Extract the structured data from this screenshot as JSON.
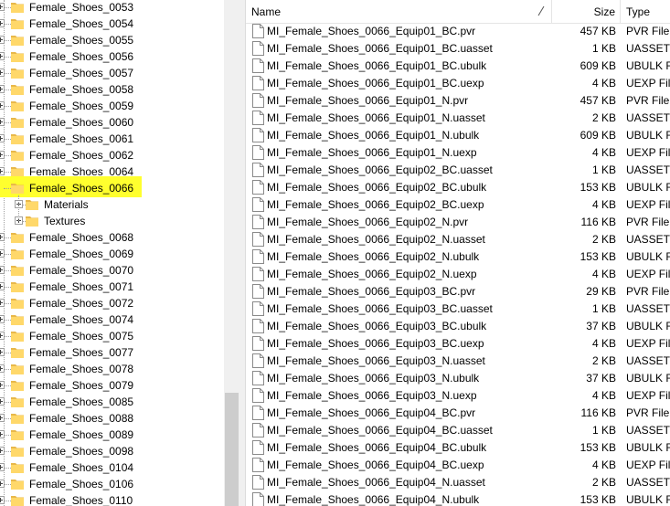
{
  "tree": {
    "items": [
      {
        "label": "Female_Shoes_0053",
        "level": 0
      },
      {
        "label": "Female_Shoes_0054",
        "level": 0
      },
      {
        "label": "Female_Shoes_0055",
        "level": 0
      },
      {
        "label": "Female_Shoes_0056",
        "level": 0
      },
      {
        "label": "Female_Shoes_0057",
        "level": 0
      },
      {
        "label": "Female_Shoes_0058",
        "level": 0
      },
      {
        "label": "Female_Shoes_0059",
        "level": 0
      },
      {
        "label": "Female_Shoes_0060",
        "level": 0
      },
      {
        "label": "Female_Shoes_0061",
        "level": 0
      },
      {
        "label": "Female_Shoes_0062",
        "level": 0
      },
      {
        "label": "Female_Shoes_0064",
        "level": 0
      },
      {
        "label": "Female_Shoes_0066",
        "level": 0,
        "selected": true
      },
      {
        "label": "Materials",
        "level": 1
      },
      {
        "label": "Textures",
        "level": 1
      },
      {
        "label": "Female_Shoes_0068",
        "level": 0
      },
      {
        "label": "Female_Shoes_0069",
        "level": 0
      },
      {
        "label": "Female_Shoes_0070",
        "level": 0
      },
      {
        "label": "Female_Shoes_0071",
        "level": 0
      },
      {
        "label": "Female_Shoes_0072",
        "level": 0
      },
      {
        "label": "Female_Shoes_0074",
        "level": 0
      },
      {
        "label": "Female_Shoes_0075",
        "level": 0
      },
      {
        "label": "Female_Shoes_0077",
        "level": 0
      },
      {
        "label": "Female_Shoes_0078",
        "level": 0
      },
      {
        "label": "Female_Shoes_0079",
        "level": 0
      },
      {
        "label": "Female_Shoes_0085",
        "level": 0
      },
      {
        "label": "Female_Shoes_0088",
        "level": 0
      },
      {
        "label": "Female_Shoes_0089",
        "level": 0
      },
      {
        "label": "Female_Shoes_0098",
        "level": 0
      },
      {
        "label": "Female_Shoes_0104",
        "level": 0
      },
      {
        "label": "Female_Shoes_0106",
        "level": 0
      },
      {
        "label": "Female_Shoes_0110",
        "level": 0
      }
    ]
  },
  "list": {
    "headers": {
      "name": "Name",
      "size": "Size",
      "type": "Type"
    },
    "files": [
      {
        "name": "MI_Female_Shoes_0066_Equip01_BC.pvr",
        "size": "457 KB",
        "type": "PVR File"
      },
      {
        "name": "MI_Female_Shoes_0066_Equip01_BC.uasset",
        "size": "1 KB",
        "type": "UASSET Fi"
      },
      {
        "name": "MI_Female_Shoes_0066_Equip01_BC.ubulk",
        "size": "609 KB",
        "type": "UBULK Fi"
      },
      {
        "name": "MI_Female_Shoes_0066_Equip01_BC.uexp",
        "size": "4 KB",
        "type": "UEXP File"
      },
      {
        "name": "MI_Female_Shoes_0066_Equip01_N.pvr",
        "size": "457 KB",
        "type": "PVR File"
      },
      {
        "name": "MI_Female_Shoes_0066_Equip01_N.uasset",
        "size": "2 KB",
        "type": "UASSET Fi"
      },
      {
        "name": "MI_Female_Shoes_0066_Equip01_N.ubulk",
        "size": "609 KB",
        "type": "UBULK Fi"
      },
      {
        "name": "MI_Female_Shoes_0066_Equip01_N.uexp",
        "size": "4 KB",
        "type": "UEXP File"
      },
      {
        "name": "MI_Female_Shoes_0066_Equip02_BC.uasset",
        "size": "1 KB",
        "type": "UASSET Fi"
      },
      {
        "name": "MI_Female_Shoes_0066_Equip02_BC.ubulk",
        "size": "153 KB",
        "type": "UBULK Fi"
      },
      {
        "name": "MI_Female_Shoes_0066_Equip02_BC.uexp",
        "size": "4 KB",
        "type": "UEXP File"
      },
      {
        "name": "MI_Female_Shoes_0066_Equip02_N.pvr",
        "size": "116 KB",
        "type": "PVR File"
      },
      {
        "name": "MI_Female_Shoes_0066_Equip02_N.uasset",
        "size": "2 KB",
        "type": "UASSET Fi"
      },
      {
        "name": "MI_Female_Shoes_0066_Equip02_N.ubulk",
        "size": "153 KB",
        "type": "UBULK Fi"
      },
      {
        "name": "MI_Female_Shoes_0066_Equip02_N.uexp",
        "size": "4 KB",
        "type": "UEXP File"
      },
      {
        "name": "MI_Female_Shoes_0066_Equip03_BC.pvr",
        "size": "29 KB",
        "type": "PVR File"
      },
      {
        "name": "MI_Female_Shoes_0066_Equip03_BC.uasset",
        "size": "1 KB",
        "type": "UASSET Fi"
      },
      {
        "name": "MI_Female_Shoes_0066_Equip03_BC.ubulk",
        "size": "37 KB",
        "type": "UBULK Fi"
      },
      {
        "name": "MI_Female_Shoes_0066_Equip03_BC.uexp",
        "size": "4 KB",
        "type": "UEXP File"
      },
      {
        "name": "MI_Female_Shoes_0066_Equip03_N.uasset",
        "size": "2 KB",
        "type": "UASSET Fi"
      },
      {
        "name": "MI_Female_Shoes_0066_Equip03_N.ubulk",
        "size": "37 KB",
        "type": "UBULK Fi"
      },
      {
        "name": "MI_Female_Shoes_0066_Equip03_N.uexp",
        "size": "4 KB",
        "type": "UEXP File"
      },
      {
        "name": "MI_Female_Shoes_0066_Equip04_BC.pvr",
        "size": "116 KB",
        "type": "PVR File"
      },
      {
        "name": "MI_Female_Shoes_0066_Equip04_BC.uasset",
        "size": "1 KB",
        "type": "UASSET Fi"
      },
      {
        "name": "MI_Female_Shoes_0066_Equip04_BC.ubulk",
        "size": "153 KB",
        "type": "UBULK Fi"
      },
      {
        "name": "MI_Female_Shoes_0066_Equip04_BC.uexp",
        "size": "4 KB",
        "type": "UEXP File"
      },
      {
        "name": "MI_Female_Shoes_0066_Equip04_N.uasset",
        "size": "2 KB",
        "type": "UASSET Fi"
      },
      {
        "name": "MI_Female_Shoes_0066_Equip04_N.ubulk",
        "size": "153 KB",
        "type": "UBULK Fi"
      }
    ]
  },
  "colors": {
    "highlight": "#ffff2e",
    "folder": "#ffd86a",
    "folder_dark": "#e8b84a"
  }
}
